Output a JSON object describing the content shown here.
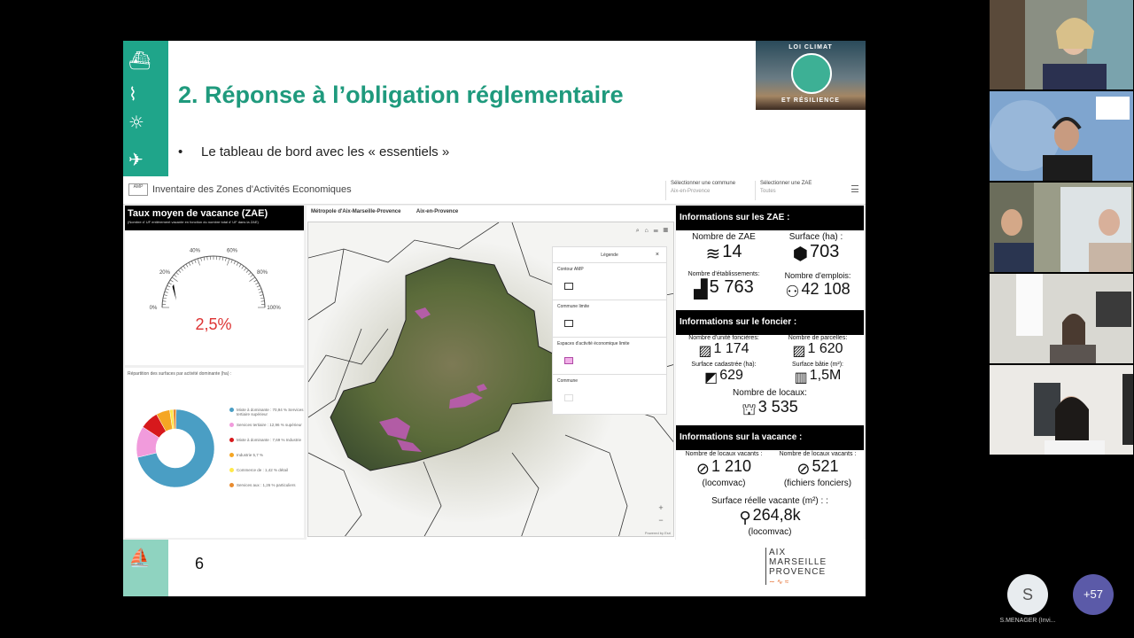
{
  "slide": {
    "title": "2. Réponse à l’obligation réglementaire",
    "bullet": "Le tableau de bord avec les « essentiels »",
    "number": "6",
    "climat_logo_text1": "LOI CLIMAT",
    "climat_logo_text2": "ET RÉSILIENCE",
    "bottom_logo": {
      "line1": "AIX",
      "line2": "MARSEILLE",
      "line3": "PROVENCE"
    }
  },
  "dashboard": {
    "title": "Inventaire des Zones d'Activités Economiques",
    "select_commune_label": "Sélectionner une commune",
    "select_commune_value": "Aix-en-Provence",
    "select_zae_label": "Sélectionner une ZAE",
    "select_zae_value": "Toutes",
    "gauge": {
      "title": "Taux moyen de vacance (ZAE)",
      "subtitle": "(Nombre d' UF entièrement vacante en fonction du nombre total d' UF dans la ZAE)",
      "value_text": "2,5%",
      "value": 2.5,
      "ticks": [
        "0%",
        "20%",
        "40%",
        "60%",
        "80%",
        "100%"
      ]
    },
    "donut": {
      "title": "Répartition des surfaces par activité dominante (ha) :",
      "legend": [
        {
          "label": "Mixte à dominante : 70,94 % Services tertiaire supérieur",
          "color": "#4a9ec4",
          "value": 70.94
        },
        {
          "label": "Services tertiaire : 12,96 % supérieur",
          "color": "#f19bdc",
          "value": 12.96
        },
        {
          "label": "Mixte à dominante : 7,69 % Industrie",
          "color": "#d7191c",
          "value": 7.69
        },
        {
          "label": "Industrie 5,7 %",
          "color": "#f5a623",
          "value": 5.7
        },
        {
          "label": "Commerce de : 1,42 % détail",
          "color": "#ffe94a",
          "value": 1.42
        },
        {
          "label": "Services aux : 1,26 % particuliers",
          "color": "#e88b2e",
          "value": 1.26
        }
      ]
    },
    "map": {
      "tab1": "Métropole d'Aix-Marseille-Provence",
      "tab2": "Aix-en-Provence",
      "legend_title": "Légende",
      "legend_items": [
        "Contour AMP",
        "Commune limite",
        "Espaces d'activité économique limite",
        "Commune"
      ],
      "zoom_in": "+",
      "zoom_out": "−",
      "credit": "Powered by Esri"
    },
    "zae": {
      "header": "Informations sur les ZAE :",
      "nb_zae_label": "Nombre de ZAE",
      "nb_zae": "14",
      "surface_label": "Surface (ha) :",
      "surface": "703",
      "etab_label": "Nombre d'établissements:",
      "etab": "5 763",
      "emplois_label": "Nombre d'emplois:",
      "emplois": "42 108"
    },
    "foncier": {
      "header": "Informations sur le foncier :",
      "uf_label": "Nombre d'unité foncières:",
      "uf": "1 174",
      "parcelles_label": "Nombre de parcelles:",
      "parcelles": "1 620",
      "cadastree_label": "Surface cadastrée (ha):",
      "cadastree": "629",
      "batie_label": "Surface bâtie (m²):",
      "batie": "1,5M",
      "locaux_label": "Nombre de locaux:",
      "locaux": "3 535"
    },
    "vacance": {
      "header": "Informations sur la vacance :",
      "vac1_label": "Nombre de locaux vacants :",
      "vac1": "1 210",
      "vac1_src": "(locomvac)",
      "vac2_label": "Nombre de locaux vacants :",
      "vac2": "521",
      "vac2_src": "(fichiers fonciers)",
      "surf_label": "Surface réelle vacante (m²) : :",
      "surf": "264,8k",
      "surf_src": "(locomvac)"
    }
  },
  "participants": {
    "avatar_initial": "S",
    "avatar_name": "S.MENAGER (Invi...",
    "more": "+57"
  }
}
